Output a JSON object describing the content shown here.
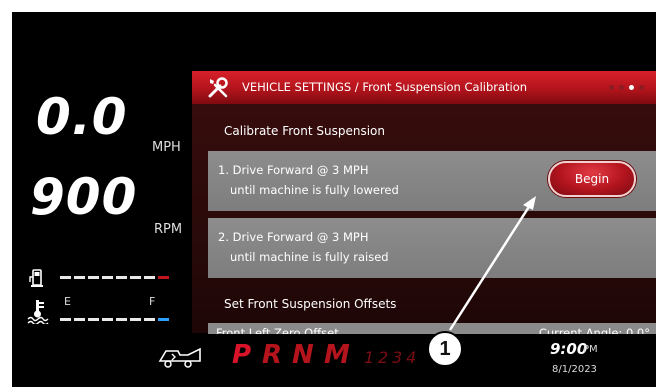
{
  "gauges": {
    "speed": {
      "value": "0.0",
      "unit": "MPH"
    },
    "rpm": {
      "value": "900",
      "unit": "RPM"
    },
    "fuel": {
      "empty_label": "E",
      "full_label": "F"
    }
  },
  "panel": {
    "title": "VEHICLE SETTINGS / Front Suspension Calibration",
    "page_count": 4,
    "active_page": 3,
    "calibrate_heading": "Calibrate Front Suspension",
    "steps": [
      {
        "line1": "1. Drive Forward @ 3 MPH",
        "line2": "until machine is fully lowered"
      },
      {
        "line1": "2. Drive Forward @ 3 MPH",
        "line2": "until machine is fully raised"
      }
    ],
    "begin_label": "Begin",
    "offsets_heading": "Set Front Suspension Offsets",
    "offset_row": {
      "label": "Front Left Zero Offset",
      "current_angle": "Current Angle: 0.0°"
    }
  },
  "gear_selector": {
    "gears": [
      "P",
      "R",
      "N",
      "M"
    ],
    "active_gear": "P",
    "numbers": [
      "1",
      "2",
      "3",
      "4"
    ]
  },
  "clock": {
    "time": "9:00",
    "ampm": "PM",
    "date": "8/1/2023"
  },
  "callout": {
    "number": "1"
  },
  "colors": {
    "accent_red": "#c2141e",
    "panel_bg": "#2a0a0a",
    "card_gray": "#858585",
    "coolant_blue": "#2ca0ff"
  }
}
